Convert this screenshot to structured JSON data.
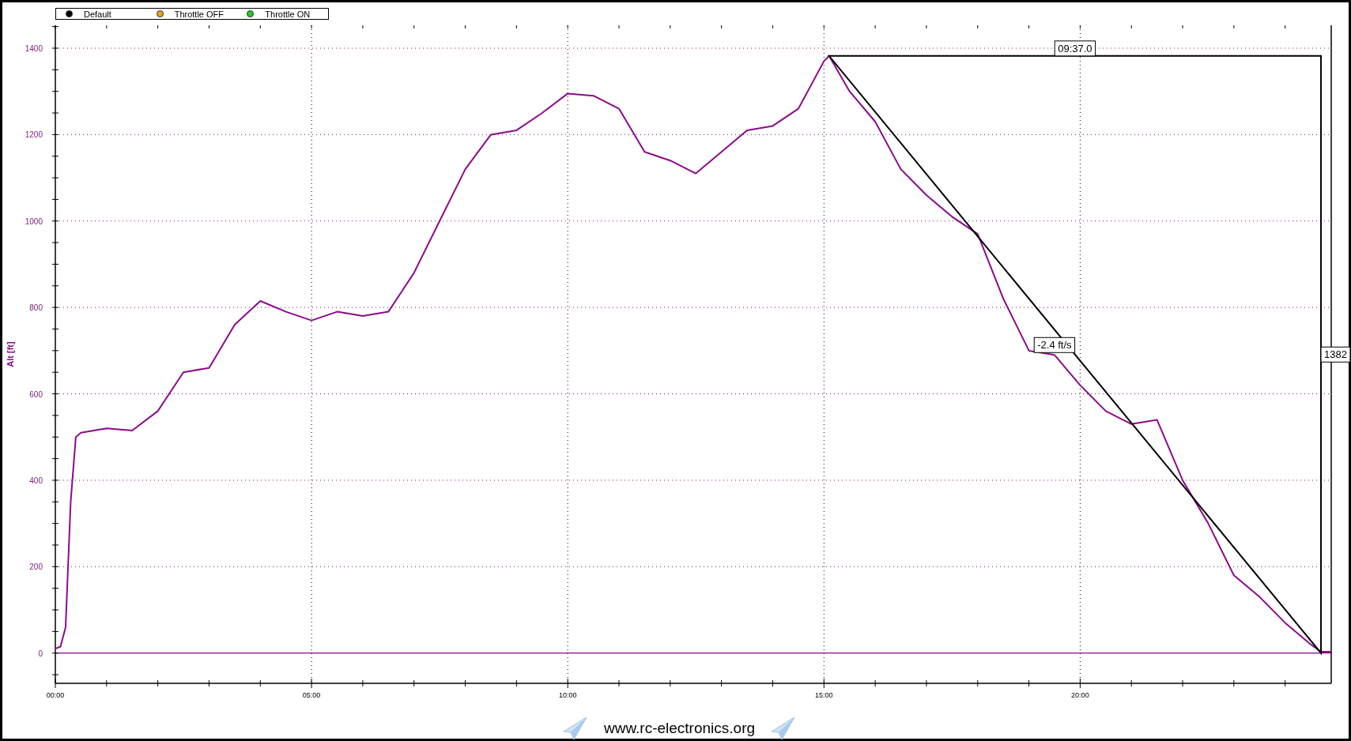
{
  "legend": [
    {
      "label": "Default",
      "color": "#000000"
    },
    {
      "label": "Throttle OFF",
      "color": "#e8a317"
    },
    {
      "label": "Throttle ON",
      "color": "#22cc22"
    }
  ],
  "chart": {
    "chart_data": {
      "type": "line",
      "ylabel": "Alt [ft]",
      "x": [
        0,
        0.1,
        0.2,
        0.3,
        0.4,
        0.5,
        1,
        1.5,
        2,
        2.5,
        3,
        3.5,
        4,
        4.5,
        5,
        5.5,
        6,
        6.5,
        7,
        7.5,
        8,
        8.5,
        9,
        9.5,
        10,
        10.5,
        11,
        11.5,
        12,
        12.5,
        13,
        13.5,
        14,
        14.5,
        15,
        15.1,
        15.5,
        16,
        16.5,
        17,
        17.5,
        18,
        18.5,
        19,
        19.5,
        20,
        20.5,
        21,
        21.5,
        22,
        22.5,
        23,
        23.5,
        24,
        24.5,
        24.7,
        24.9
      ],
      "series": [
        {
          "color": "#8b0a8b",
          "values": [
            10,
            15,
            60,
            350,
            500,
            510,
            520,
            515,
            560,
            650,
            660,
            760,
            815,
            790,
            770,
            790,
            780,
            790,
            880,
            1000,
            1120,
            1200,
            1210,
            1250,
            1295,
            1290,
            1260,
            1160,
            1140,
            1110,
            1160,
            1210,
            1220,
            1260,
            1370,
            1382,
            1300,
            1230,
            1120,
            1060,
            1010,
            970,
            820,
            700,
            690,
            620,
            560,
            530,
            540,
            400,
            300,
            180,
            130,
            70,
            20,
            3,
            3
          ]
        }
      ],
      "xlim": [
        0,
        24.9
      ],
      "ylim": [
        -70,
        1453
      ],
      "xticks": [
        {
          "value": 0,
          "label": "00:00"
        },
        {
          "value": 5,
          "label": "05:00"
        },
        {
          "value": 10,
          "label": "10:00"
        },
        {
          "value": 15,
          "label": "15:00"
        },
        {
          "value": 20,
          "label": "20:00"
        }
      ],
      "yticks": [
        0,
        200,
        400,
        600,
        800,
        1000,
        1200,
        1400
      ],
      "grid": true,
      "ref_lines": [
        {
          "axis": "y",
          "value": 0,
          "color": "#8b0a8b"
        }
      ],
      "annotations": [
        "09:37.0",
        "-2.4 ft/s",
        "1382"
      ]
    }
  },
  "footer": {
    "text": "www.rc-electronics.org"
  }
}
